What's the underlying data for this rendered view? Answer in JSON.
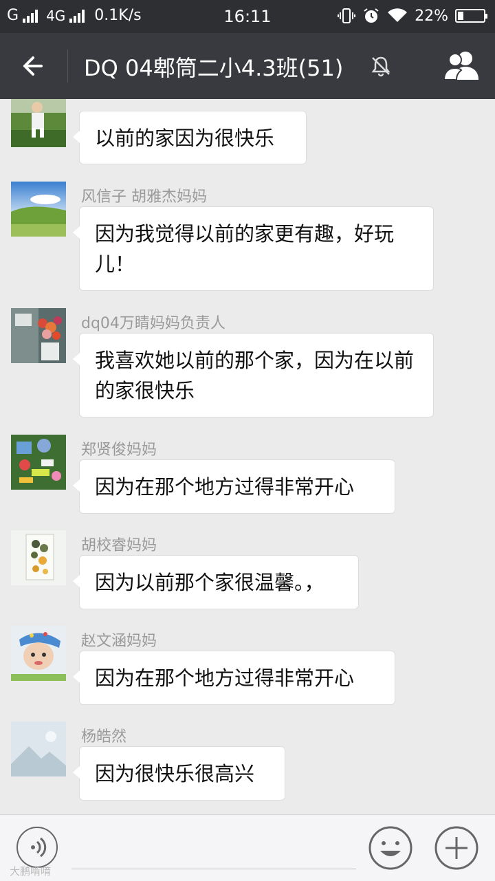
{
  "status_bar": {
    "carrier1": "G",
    "carrier2": "4G",
    "speed": "0.1K/s",
    "time": "16:11",
    "battery_percent": "22%",
    "battery_level": 0.22
  },
  "nav": {
    "title": "DQ 04郫筒二小4.3班(51)",
    "back_icon": "arrow-left-icon",
    "mute_icon": "bell-muted-icon",
    "members_icon": "group-members-icon"
  },
  "messages": [
    {
      "sender": "",
      "text": "以前的家因为很快乐",
      "avatar": "child-photo"
    },
    {
      "sender": "风信子  胡雅杰妈妈",
      "text": "因为我觉得以前的家更有趣，好玩儿！",
      "avatar": "grassland-photo"
    },
    {
      "sender": "dq04万睛妈妈负责人",
      "text": "我喜欢她以前的那个家，因为在以前的家很快乐",
      "avatar": "flowers-photo"
    },
    {
      "sender": "郑贤俊妈妈",
      "text": "因为在那个地方过得非常开心",
      "avatar": "toys-photo"
    },
    {
      "sender": "胡校睿妈妈",
      "text": "因为以前那个家很温馨。，",
      "avatar": "leaf-art-photo"
    },
    {
      "sender": "赵文涵妈妈",
      "text": "因为在那个地方过得非常开心",
      "avatar": "baby-photo"
    },
    {
      "sender": "杨皓然",
      "text": "因为很快乐很高兴",
      "avatar": "placeholder-image"
    }
  ],
  "input": {
    "voice_icon": "voice-icon",
    "emoji_icon": "emoji-icon",
    "plus_icon": "plus-icon"
  },
  "watermark": "大鹏啃唷"
}
